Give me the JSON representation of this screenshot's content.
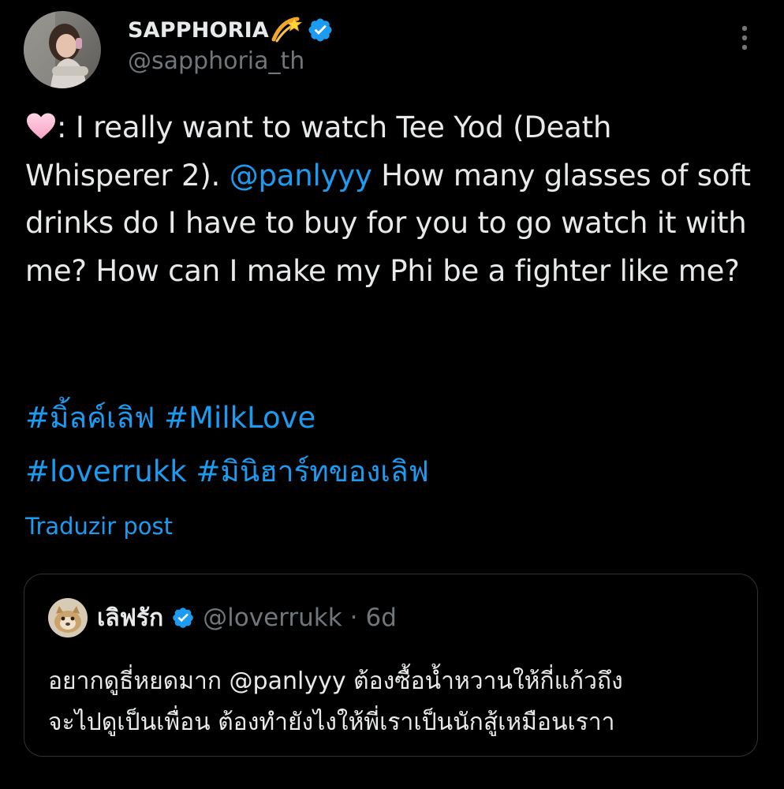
{
  "author": {
    "display_name": "SAPPHORIA",
    "handle": "@sapphoria_th",
    "verified": true
  },
  "tweet": {
    "text_before_mention": ": I really want to watch Tee Yod (Death Whisperer 2). ",
    "mention": "@panlyyy",
    "text_after_mention": " How many glasses of soft drinks do I have to buy for you to go watch it with me? How can I make my Phi be a fighter like me?",
    "hashtags_line1": [
      "#มิ้ลค์เลิฟ",
      "#MilkLove"
    ],
    "hashtags_line2": [
      "#loverrukk",
      "#มินิฮาร์ทของเลิฟ"
    ],
    "translate_label": "Traduzir post"
  },
  "quote": {
    "display_name": "เลิฟรัก",
    "handle": "@loverrukk",
    "separator": "·",
    "time": "6d",
    "verified": true,
    "line1": "อยากดูธี่หยดมาก @panlyyy ต้องซื้อน้ำหวานให้กี่แก้วถึง",
    "line2": "จะไปดูเป็นเพื่อน ต้องทำยังไงให้พี่เราเป็นนักสู้เหมือนเราา"
  },
  "colors": {
    "background": "#000000",
    "text": "#e7e9ea",
    "secondary": "#71767b",
    "link": "#1d9bf0",
    "border": "#2f3336"
  },
  "icons": {
    "verified": "verified-badge-icon",
    "more": "more-options-icon",
    "heart": "pink-heart-emoji",
    "dizzy": "dizzy-emoji"
  }
}
